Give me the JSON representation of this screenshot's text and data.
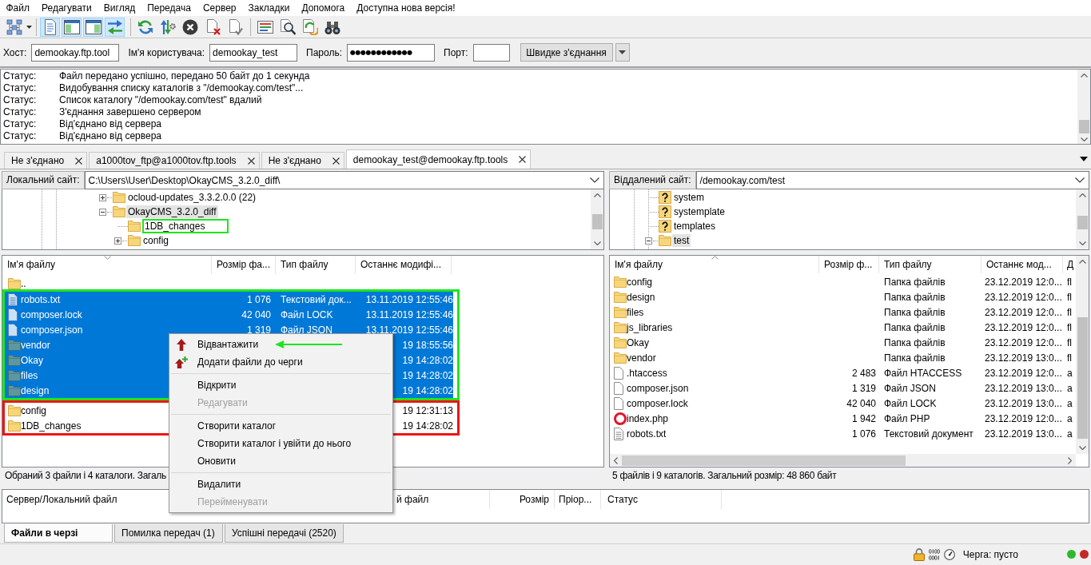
{
  "menu_bar": [
    "Файл",
    "Редагувати",
    "Вигляд",
    "Передача",
    "Сервер",
    "Закладки",
    "Допомога",
    "Доступна нова версія!"
  ],
  "toolbar": {
    "view_toggles": [
      {
        "pressed": true
      },
      {
        "pressed": true
      },
      {
        "pressed": true
      },
      {
        "pressed": true
      }
    ]
  },
  "quickconnect": {
    "fields": [
      {
        "label": "Хост:",
        "kind": "text",
        "value": "demookay.ftp.tool"
      },
      {
        "label": "Ім'я користувача:",
        "kind": "text",
        "value": "demookay_test"
      },
      {
        "label": "Пароль:",
        "kind": "password",
        "value": "●●●●●●●●●●●●"
      },
      {
        "label": "Порт:",
        "kind": "text"
      }
    ],
    "button": "Швидке з'єднання"
  },
  "message_log": [
    {
      "type": "Статус:",
      "text": "Файл передано успішно, передано 50 байт до 1 секунда"
    },
    {
      "type": "Статус:",
      "text": "Видобування списку каталогів з \"/demookay.com/test\"..."
    },
    {
      "type": "Статус:",
      "text": "Список каталогу \"/demookay.com/test\" вдалий"
    },
    {
      "type": "Статус:",
      "text": "З'єднання завершено сервером"
    },
    {
      "type": "Статус:",
      "text": "Від'єднано від сервера"
    },
    {
      "type": "Статус:",
      "text": "Від'єднано від сервера"
    }
  ],
  "tabs": [
    {
      "label": "Не з'єднано",
      "selected": false
    },
    {
      "label": "a1000tov_ftp@a1000tov.ftp.tools",
      "selected": false
    },
    {
      "label": "Не з'єднано",
      "selected": false
    },
    {
      "label": "demookay_test@demookay.ftp.tools",
      "selected": true
    }
  ],
  "local": {
    "site_label": "Локальний сайт:",
    "path": "C:\\Users\\User\\Desktop\\OkayCMS_3.2.0_diff\\",
    "tree": [
      {
        "kind": "folder",
        "name": "ocloud-updates_3.3.2.0.0 (22)",
        "expanded": false,
        "selected": false
      },
      {
        "kind": "folder",
        "name": "OkayCMS_3.2.0_diff",
        "expanded": true,
        "selected": true,
        "children": [
          {
            "kind": "folder",
            "name": "1DB_changes",
            "selected": false,
            "frame": {
              "color": "#1ee61e"
            }
          },
          {
            "kind": "folder",
            "name": "config",
            "expanded": false,
            "selected": false
          }
        ]
      }
    ],
    "columns": [
      {
        "label": "Ім'я файлу",
        "sorted": true,
        "descending": true
      },
      {
        "label": "Розмір фа...",
        "sorted": false
      },
      {
        "label": "Тип файлу",
        "sorted": false
      },
      {
        "label": "Останнє модифі...",
        "sorted": false
      }
    ],
    "row_groups": [
      {
        "rows": [
          {
            "kind": "parent",
            "name": "..",
            "selected": false
          }
        ]
      },
      {
        "frame": {
          "color": "#1ee61e"
        },
        "rows": [
          {
            "kind": "text",
            "name": "robots.txt",
            "size": "1 076",
            "type": "Текстовий док...",
            "modified": "13.11.2019 12:55:46",
            "selected": true
          },
          {
            "kind": "file",
            "name": "composer.lock",
            "size": "42 040",
            "type": "Файл LOCK",
            "modified": "13.11.2019 12:55:46",
            "selected": true
          },
          {
            "kind": "file",
            "name": "composer.json",
            "size": "1 319",
            "type": "Файл JSON",
            "modified": "13.11.2019 12:55:46",
            "selected": true
          },
          {
            "kind": "folder",
            "name": "vendor",
            "modified": "19 18:55:56",
            "selected": true
          },
          {
            "kind": "folder",
            "name": "Okay",
            "modified": "19 14:28:02",
            "selected": true
          },
          {
            "kind": "folder",
            "name": "files",
            "modified": "19 14:28:02",
            "selected": true
          },
          {
            "kind": "folder",
            "name": "design",
            "modified": "19 14:28:02",
            "selected": true
          }
        ]
      },
      {
        "frame": {
          "color": "#f01414"
        },
        "rows": [
          {
            "kind": "folder",
            "name": "config",
            "modified": "19 12:31:13",
            "selected": false
          },
          {
            "kind": "folder",
            "name": "1DB_changes",
            "modified": "19 14:28:02",
            "selected": false
          }
        ]
      }
    ],
    "status": "Обраний 3 файли і 4 каталоги. Загаль"
  },
  "remote": {
    "site_label": "Віддалений сайт:",
    "path": "/demookay.com/test",
    "tree": [
      {
        "kind": "unknown",
        "name": "system",
        "selected": false
      },
      {
        "kind": "unknown",
        "name": "systemplate",
        "selected": false
      },
      {
        "kind": "unknown",
        "name": "templates",
        "selected": false
      },
      {
        "kind": "folder",
        "name": "test",
        "expanded": true,
        "selected": true
      }
    ],
    "columns": [
      {
        "label": "Ім'я файлу",
        "sorted": true,
        "descending": false
      },
      {
        "label": "Розмір ф...",
        "sorted": false
      },
      {
        "label": "Тип файлу",
        "sorted": false
      },
      {
        "label": "Останнє мод...",
        "sorted": false
      },
      {
        "label": "Д",
        "sorted": false
      }
    ],
    "row_groups": [
      {
        "rows": [
          {
            "kind": "folder",
            "name": "config",
            "type": "Папка файлів",
            "modified": "23.12.2019 12:0...",
            "column_5": "fl",
            "selected": false
          },
          {
            "kind": "folder",
            "name": "design",
            "type": "Папка файлів",
            "modified": "23.12.2019 12:0...",
            "column_5": "fl",
            "selected": false
          },
          {
            "kind": "folder",
            "name": "files",
            "type": "Папка файлів",
            "modified": "23.12.2019 12:0...",
            "column_5": "fl",
            "selected": false
          },
          {
            "kind": "folder",
            "name": "js_libraries",
            "type": "Папка файлів",
            "modified": "23.12.2019 12:0...",
            "column_5": "fl",
            "selected": false
          },
          {
            "kind": "folder",
            "name": "Okay",
            "type": "Папка файлів",
            "modified": "23.12.2019 12:0...",
            "column_5": "fl",
            "selected": false
          },
          {
            "kind": "folder",
            "name": "vendor",
            "type": "Папка файлів",
            "modified": "23.12.2019 13:0...",
            "column_5": "fl",
            "selected": false
          },
          {
            "kind": "file",
            "name": ".htaccess",
            "size": "2 483",
            "type": "Файл HTACCESS",
            "modified": "23.12.2019 12:0...",
            "column_5": "a",
            "selected": false
          },
          {
            "kind": "file",
            "name": "composer.json",
            "size": "1 319",
            "type": "Файл JSON",
            "modified": "23.12.2019 13:0...",
            "column_5": "a",
            "selected": false
          },
          {
            "kind": "file",
            "name": "composer.lock",
            "size": "42 040",
            "type": "Файл LOCK",
            "modified": "23.12.2019 13:0...",
            "column_5": "a",
            "selected": false
          },
          {
            "kind": "web",
            "name": "index.php",
            "size": "1 942",
            "type": "Файл PHP",
            "modified": "23.12.2019 12:0...",
            "column_5": "a",
            "selected": false
          },
          {
            "kind": "text",
            "name": "robots.txt",
            "size": "1 076",
            "type": "Текстовий документ",
            "modified": "23.12.2019 13:0...",
            "column_5": "a",
            "selected": false
          }
        ]
      }
    ],
    "status": "5 файлів і 9 каталогів. Загальний розмір: 48 860 байт"
  },
  "context_menu": {
    "items": [
      {
        "kind": "upload",
        "label": "Відвантажити",
        "disabled": false,
        "pointer": {
          "color": "#1ee61e"
        }
      },
      {
        "kind": "enqueue",
        "label": "Додати файли до черги",
        "disabled": false
      },
      {
        "kind": "separator"
      },
      {
        "kind": "plain",
        "label": "Відкрити",
        "disabled": false
      },
      {
        "kind": "plain",
        "label": "Редагувати",
        "disabled": true
      },
      {
        "kind": "separator"
      },
      {
        "kind": "plain",
        "label": "Створити каталог",
        "disabled": false
      },
      {
        "kind": "plain",
        "label": "Створити каталог і увійти до нього",
        "disabled": false
      },
      {
        "kind": "plain",
        "label": "Оновити",
        "disabled": false
      },
      {
        "kind": "separator"
      },
      {
        "kind": "plain",
        "label": "Видалити",
        "disabled": false
      },
      {
        "kind": "plain",
        "label": "Перейменувати",
        "disabled": true
      }
    ]
  },
  "queue": {
    "columns": [
      {
        "label": "Сервер/Локальний файл"
      },
      {
        "label": "й файл"
      },
      {
        "label": "Розмір"
      },
      {
        "label": "Пріор..."
      },
      {
        "label": "Статус"
      }
    ],
    "tabs": [
      {
        "label": "Файли в черзі",
        "selected": true
      },
      {
        "label": "Помилка передач (1)",
        "selected": false
      },
      {
        "label": "Успішні передачі (2520)",
        "selected": false
      }
    ]
  },
  "status_bar": {
    "queue_text": "Черга: пусто",
    "indicators": [
      {
        "color": "#2eb82e"
      },
      {
        "color": "#c62828"
      }
    ]
  }
}
